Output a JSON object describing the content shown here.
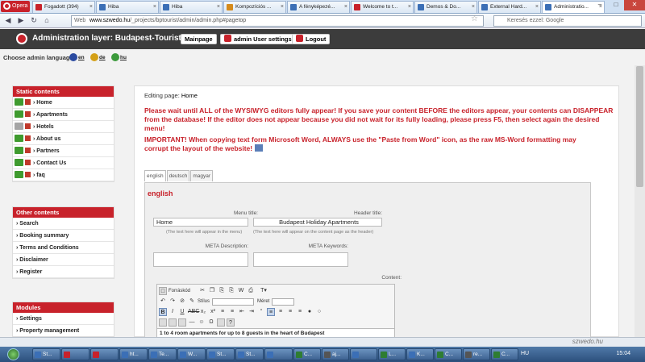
{
  "browser": {
    "opera_label": "Opera",
    "tabs": [
      {
        "label": "Fogadott (394)",
        "color": "#c8222b"
      },
      {
        "label": "Hiba",
        "color": "#3b6fb6"
      },
      {
        "label": "Hiba",
        "color": "#3b6fb6"
      },
      {
        "label": "Kompozíciós ...",
        "color": "#d58a1b"
      },
      {
        "label": "A fényképezé...",
        "color": "#3b6fb6"
      },
      {
        "label": "Welcome to t...",
        "color": "#c8222b"
      },
      {
        "label": "Demos & Do...",
        "color": "#3b6fb6"
      },
      {
        "label": "External Hard...",
        "color": "#3b6fb6"
      },
      {
        "label": "Administratio...",
        "color": "#3b6fb6"
      }
    ],
    "address_prefix": "Web",
    "address_domain": "www.szwedo.hu",
    "address_path": "/_projects/bptourist/admin/admin.php#pagetop",
    "search_placeholder": "Keresés ezzel: Google"
  },
  "header": {
    "title": "Administration layer: Budapest-Tourist",
    "buttons": {
      "mainpage": "Mainpage",
      "users": "admin User settings",
      "logout": "Logout"
    }
  },
  "language": {
    "label": "Choose admin language:",
    "options": [
      {
        "code": "en",
        "color": "#2a4aa0"
      },
      {
        "code": "de",
        "color": "#d4a017"
      },
      {
        "code": "hu",
        "color": "#3c9a3c"
      }
    ]
  },
  "sidebar": {
    "static": {
      "title": "Static contents",
      "items": [
        "Home",
        "Apartments",
        "Hotels",
        "About us",
        "Partners",
        "Contact Us",
        "faq"
      ]
    },
    "other": {
      "title": "Other contents",
      "items": [
        "Search",
        "Booking summary",
        "Terms and Conditions",
        "Disclaimer",
        "Register"
      ]
    },
    "modules": {
      "title": "Modules",
      "items": [
        "Settings",
        "Property management"
      ]
    }
  },
  "main": {
    "editing_label": "Editing page:",
    "editing_page": "Home",
    "warning1": "Please wait until ALL of the WYSIWYG editors fully appear! If you save your content BEFORE the editors appear, your contents can DISAPPEAR from the database! If the editor does not appear because you did not wait for its fully loading, please press F5, then select again the desired menu!",
    "warning2": "IMPORTANT! When copying text form Microsoft Word, ALWAYS use the \"Paste from Word\" icon, as the raw MS-Word formatting may corrupt the layout of the website!",
    "lang_tabs": [
      "english",
      "deutsch",
      "magyar"
    ],
    "editor": {
      "section_title": "english",
      "menu_title_label": "Menu title:",
      "menu_title_value": "Home",
      "menu_hint": "(The text here will appear in the menu)",
      "header_title_label": "Header title:",
      "header_title_value": "Budapest Holiday Apartments",
      "header_hint": "(The text here will appear on the content page as the header)",
      "meta_desc_label": "META Description:",
      "meta_kw_label": "META Keywords:",
      "content_label": "Content:",
      "toolbar": {
        "source": "Forráskód",
        "style": "Stílus",
        "size": "Méret"
      },
      "body_text": "1 to 4 room apartments for up to 8 guests in the heart of Budapest"
    }
  },
  "statusbar": {
    "watermark": "szwedo.hu"
  },
  "taskbar": {
    "tasks": [
      {
        "label": "St...",
        "color": "#3b6fb6"
      },
      {
        "label": "",
        "color": "#c8222b"
      },
      {
        "label": "",
        "color": "#c8222b"
      },
      {
        "label": "ht...",
        "color": "#3b6fb6"
      },
      {
        "label": "Te...",
        "color": "#3b6fb6"
      },
      {
        "label": "W...",
        "color": "#3b6fb6"
      },
      {
        "label": "St...",
        "color": "#3b6fb6"
      },
      {
        "label": "St...",
        "color": "#3b6fb6"
      },
      {
        "label": "",
        "color": "#3b6fb6"
      },
      {
        "label": "C...",
        "color": "#2e7d32"
      },
      {
        "label": "aj...",
        "color": "#555555"
      },
      {
        "label": "",
        "color": "#3b6fb6"
      },
      {
        "label": "L...",
        "color": "#2e7d32"
      },
      {
        "label": "K...",
        "color": "#3b6fb6"
      },
      {
        "label": "C...",
        "color": "#2e7d32"
      },
      {
        "label": "re...",
        "color": "#555555"
      },
      {
        "label": "C...",
        "color": "#2e7d32"
      }
    ],
    "lang": "HU",
    "clock": "15:04"
  }
}
